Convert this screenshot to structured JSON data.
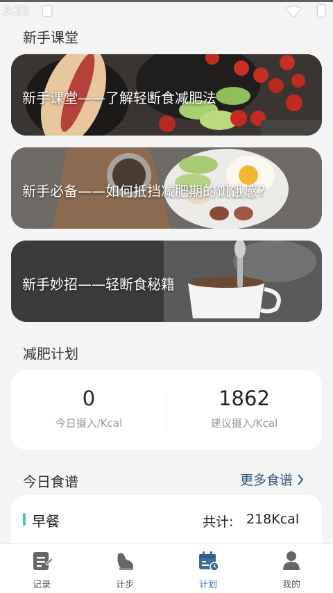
{
  "status_bar": {
    "time": "3:22"
  },
  "sections": {
    "beginner_title": "新手课堂",
    "plan_title": "减肥计划",
    "recipe_title": "今日食谱",
    "more_recipes": "更多食谱"
  },
  "beginner_cards": [
    {
      "label": "新手课堂——了解轻断食减肥法"
    },
    {
      "label": "新手必备——如何抵挡减肥期的饥饿感?"
    },
    {
      "label": "新手妙招——轻断食秘籍"
    }
  ],
  "plan": {
    "today_intake_value": "0",
    "today_intake_label": "今日摄入/Kcal",
    "suggested_intake_value": "1862",
    "suggested_intake_label": "建议摄入/Kcal"
  },
  "meal": {
    "name": "早餐",
    "total_label": "共计:",
    "total_value": "218Kcal"
  },
  "tabs": [
    {
      "label": "记录",
      "icon": "record-icon"
    },
    {
      "label": "计步",
      "icon": "shoe-icon"
    },
    {
      "label": "计划",
      "icon": "calendar-icon"
    },
    {
      "label": "我的",
      "icon": "person-icon"
    }
  ],
  "colors": {
    "accent": "#3a6d9c",
    "link": "#2d5a87",
    "meal_marker": "#3ecfa0",
    "background": "#f4f4f4"
  }
}
